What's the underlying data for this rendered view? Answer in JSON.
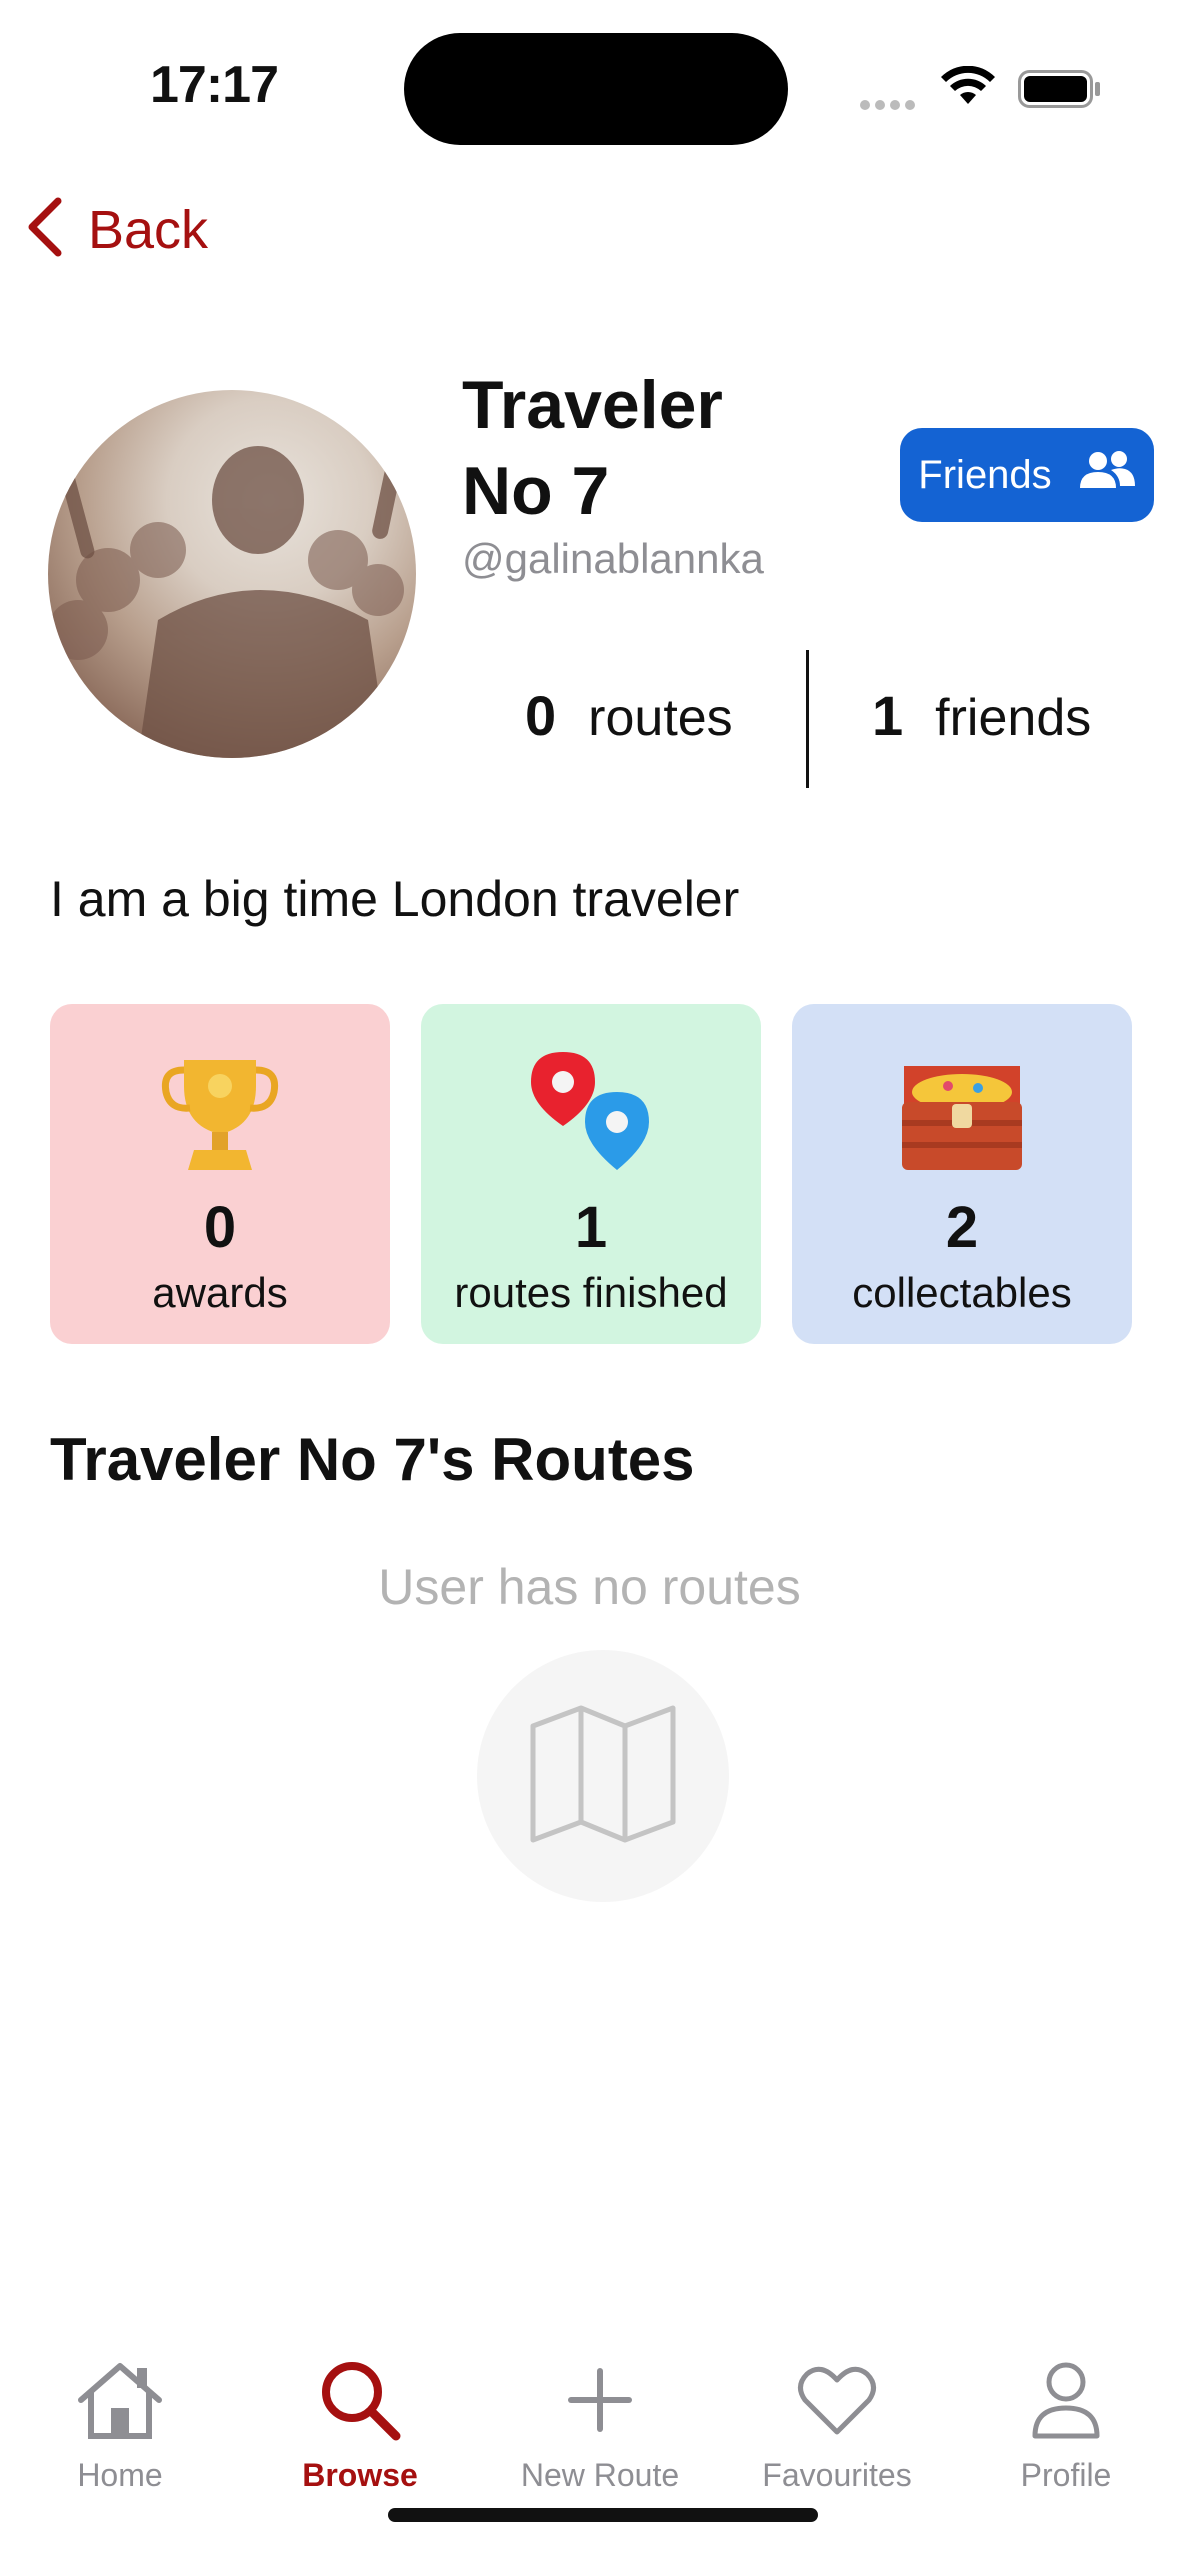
{
  "status_bar": {
    "time": "17:17"
  },
  "nav": {
    "back_label": "Back"
  },
  "profile": {
    "name_line1": "Traveler",
    "name_line2": "No 7",
    "handle": "@galinablannka",
    "friends_button_label": "Friends",
    "routes_count": "0",
    "routes_label": "routes",
    "friends_count": "1",
    "friends_label": "friends",
    "bio": "I am a big time London traveler"
  },
  "stats_cards": [
    {
      "icon": "trophy-icon",
      "value": "0",
      "label": "awards",
      "color": "#fad0d2"
    },
    {
      "icon": "map-pins-icon",
      "value": "1",
      "label": "routes finished",
      "color": "#d2f5e0"
    },
    {
      "icon": "treasure-chest-icon",
      "value": "2",
      "label": "collectables",
      "color": "#d3e0f6"
    }
  ],
  "routes_section": {
    "title": "Traveler No 7's Routes",
    "empty_text": "User has no routes"
  },
  "tab_bar": {
    "items": [
      {
        "label": "Home",
        "icon": "home-icon",
        "active": false
      },
      {
        "label": "Browse",
        "icon": "search-icon",
        "active": true
      },
      {
        "label": "New Route",
        "icon": "plus-icon",
        "active": false
      },
      {
        "label": "Favourites",
        "icon": "heart-icon",
        "active": false
      },
      {
        "label": "Profile",
        "icon": "person-icon",
        "active": false
      }
    ]
  },
  "colors": {
    "accent": "#a51010",
    "friends_button": "#1463d3",
    "muted": "#8e8e93"
  }
}
